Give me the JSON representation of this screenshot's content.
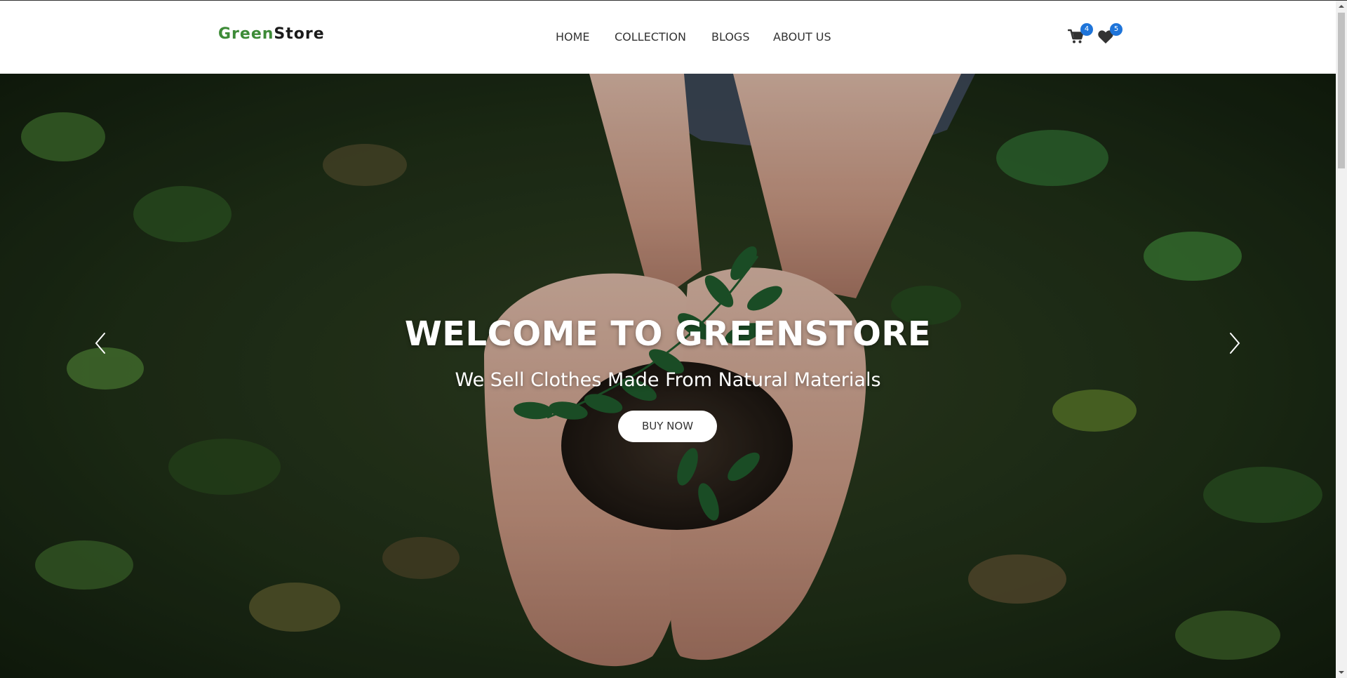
{
  "header": {
    "logo": {
      "part1": "Green",
      "part2": "Store"
    },
    "nav": [
      {
        "label": "HOME"
      },
      {
        "label": "COLLECTION"
      },
      {
        "label": "BLOGS"
      },
      {
        "label": "ABOUT US"
      }
    ],
    "cart": {
      "icon": "cart-icon",
      "count": "4"
    },
    "wishlist": {
      "icon": "heart-icon",
      "count": "5"
    }
  },
  "hero": {
    "title": "WELCOME TO GREENSTORE",
    "subtitle": "We Sell Clothes Made From Natural Materials",
    "button_label": "BUY NOW",
    "prev_icon": "chevron-left-icon",
    "next_icon": "chevron-right-icon"
  },
  "colors": {
    "brand_green": "#3d8b37",
    "badge_blue": "#1e74d9",
    "nav_text": "#333333"
  }
}
